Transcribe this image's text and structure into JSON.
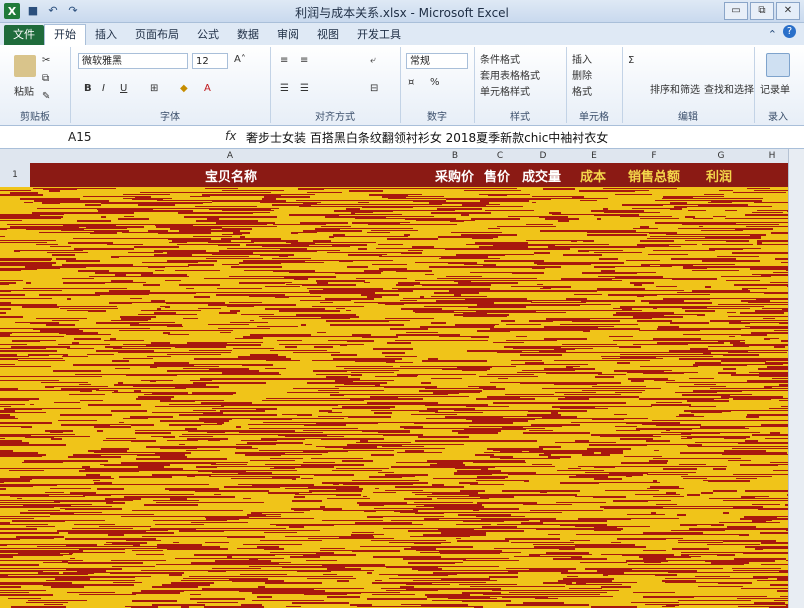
{
  "window": {
    "title": "利润与成本关系.xlsx - Microsoft Excel",
    "app_icon_label": "X",
    "controls": [
      "▭",
      "⧉",
      "✕"
    ]
  },
  "ribbon": {
    "tabs": [
      "文件",
      "开始",
      "插入",
      "页面布局",
      "公式",
      "数据",
      "审阅",
      "视图",
      "开发工具"
    ],
    "active_tab": "开始",
    "groups": {
      "clipboard": {
        "label": "剪贴板",
        "paste": "粘贴"
      },
      "font": {
        "label": "字体",
        "font_name": "微软雅黑",
        "font_size": "12",
        "bold": "B",
        "italic": "I",
        "underline": "U"
      },
      "alignment": {
        "label": "对齐方式"
      },
      "number": {
        "label": "数字",
        "format": "常规",
        "percent": "%"
      },
      "styles": {
        "label": "样式",
        "conditional": "条件格式",
        "table": "套用表格格式",
        "cell_styles": "单元格样式"
      },
      "cells": {
        "label": "单元格",
        "insert": "插入",
        "delete": "删除",
        "format": "格式"
      },
      "editing": {
        "label": "编辑",
        "sort": "排序和筛选",
        "find": "查找和选择"
      },
      "record": {
        "label": "录入",
        "form": "记录单"
      }
    }
  },
  "formula_bar": {
    "name_box": "A15",
    "fx": "fx",
    "content": "奢步士女装 百搭黑白条纹翻领衬衫女 2018夏季新款chic中袖衬衣女"
  },
  "sheet": {
    "columns": [
      "A",
      "B",
      "C",
      "D",
      "E",
      "F",
      "G",
      "H"
    ],
    "row_number": "1",
    "headers": [
      "宝贝名称",
      "采购价",
      "售价",
      "成交量",
      "成本",
      "销售总额",
      "利润"
    ]
  },
  "colors": {
    "header_row": "#8b1a14",
    "body_fill": "#f0c419",
    "body_noise": "#a8180e"
  }
}
